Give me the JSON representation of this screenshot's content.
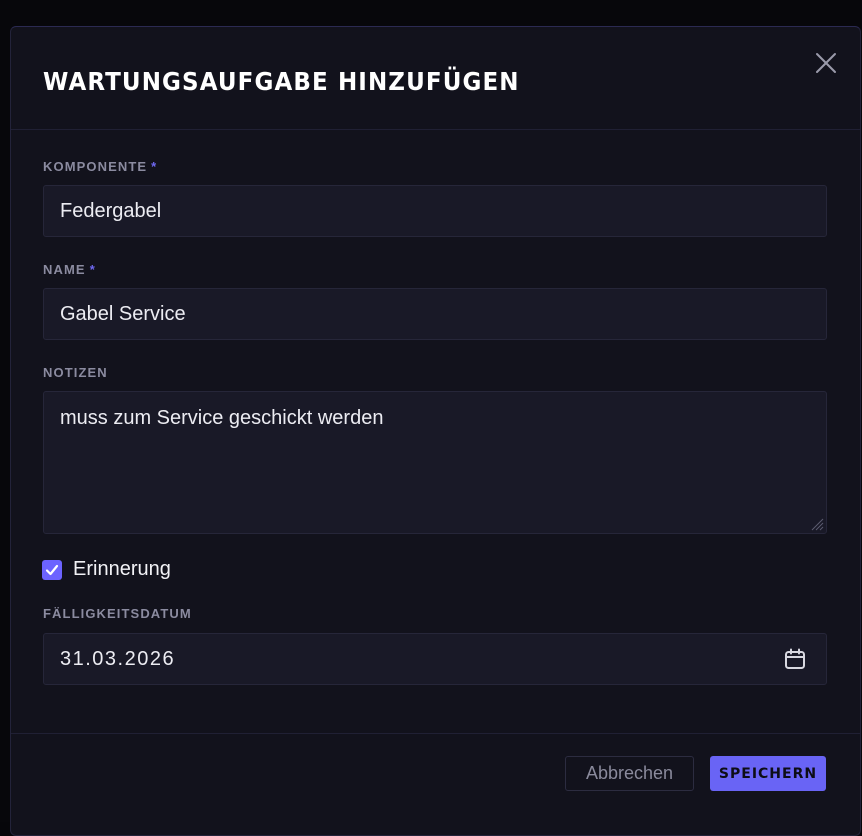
{
  "dialog": {
    "title": "WARTUNGSAUFGABE HINZUFÜGEN",
    "close_icon": "close-icon"
  },
  "fields": {
    "component": {
      "label": "KOMPONENTE",
      "required_marker": "*",
      "value": "Federgabel"
    },
    "name": {
      "label": "NAME",
      "required_marker": "*",
      "value": "Gabel Service"
    },
    "notes": {
      "label": "NOTIZEN",
      "value": "muss zum Service geschickt werden"
    },
    "reminder": {
      "label": "Erinnerung",
      "checked": true
    },
    "due_date": {
      "label": "FÄLLIGKEITSDATUM",
      "value": "31.03.2026",
      "icon": "calendar-icon"
    }
  },
  "footer": {
    "cancel_label": "Abbrechen",
    "save_label": "SPEICHERN"
  },
  "colors": {
    "accent": "#6c63ff",
    "background": "#12121c",
    "input_background": "#191927"
  }
}
